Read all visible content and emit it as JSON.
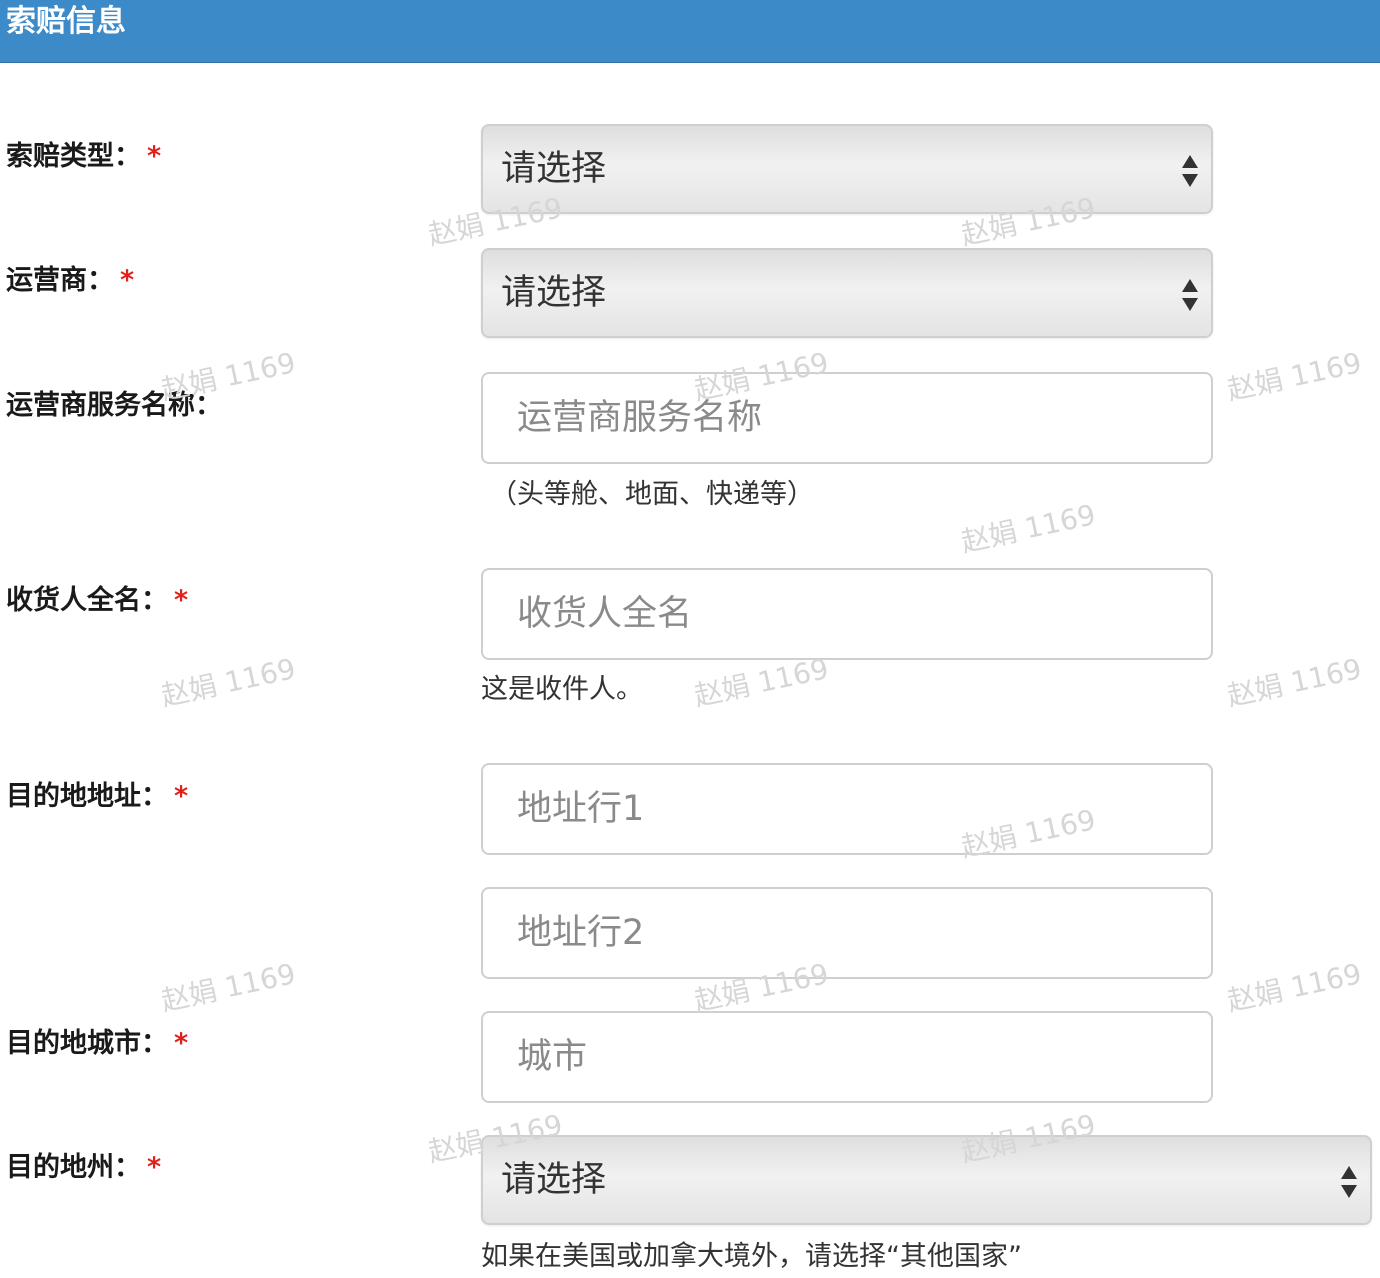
{
  "header": {
    "title": "索赔信息"
  },
  "form": {
    "claim_type": {
      "label": "索赔类型：",
      "required_mark": "*",
      "value": "请选择"
    },
    "carrier": {
      "label": "运营商：",
      "required_mark": "*",
      "value": "请选择"
    },
    "carrier_service": {
      "label": "运营商服务名称：",
      "placeholder": "运营商服务名称",
      "help": "（头等舱、地面、快递等）"
    },
    "recipient_name": {
      "label": "收货人全名：",
      "required_mark": "*",
      "placeholder": "收货人全名",
      "help": "这是收件人。"
    },
    "dest_address": {
      "label": "目的地地址：",
      "required_mark": "*",
      "placeholder_line1": "地址行1",
      "placeholder_line2": "地址行2"
    },
    "dest_city": {
      "label": "目的地城市：",
      "required_mark": "*",
      "placeholder": "城市"
    },
    "dest_state": {
      "label": "目的地州：",
      "required_mark": "*",
      "value": "请选择",
      "help": "如果在美国或加拿大境外，请选择“其他国家”"
    }
  },
  "watermark": {
    "text": "赵娟 1169"
  }
}
